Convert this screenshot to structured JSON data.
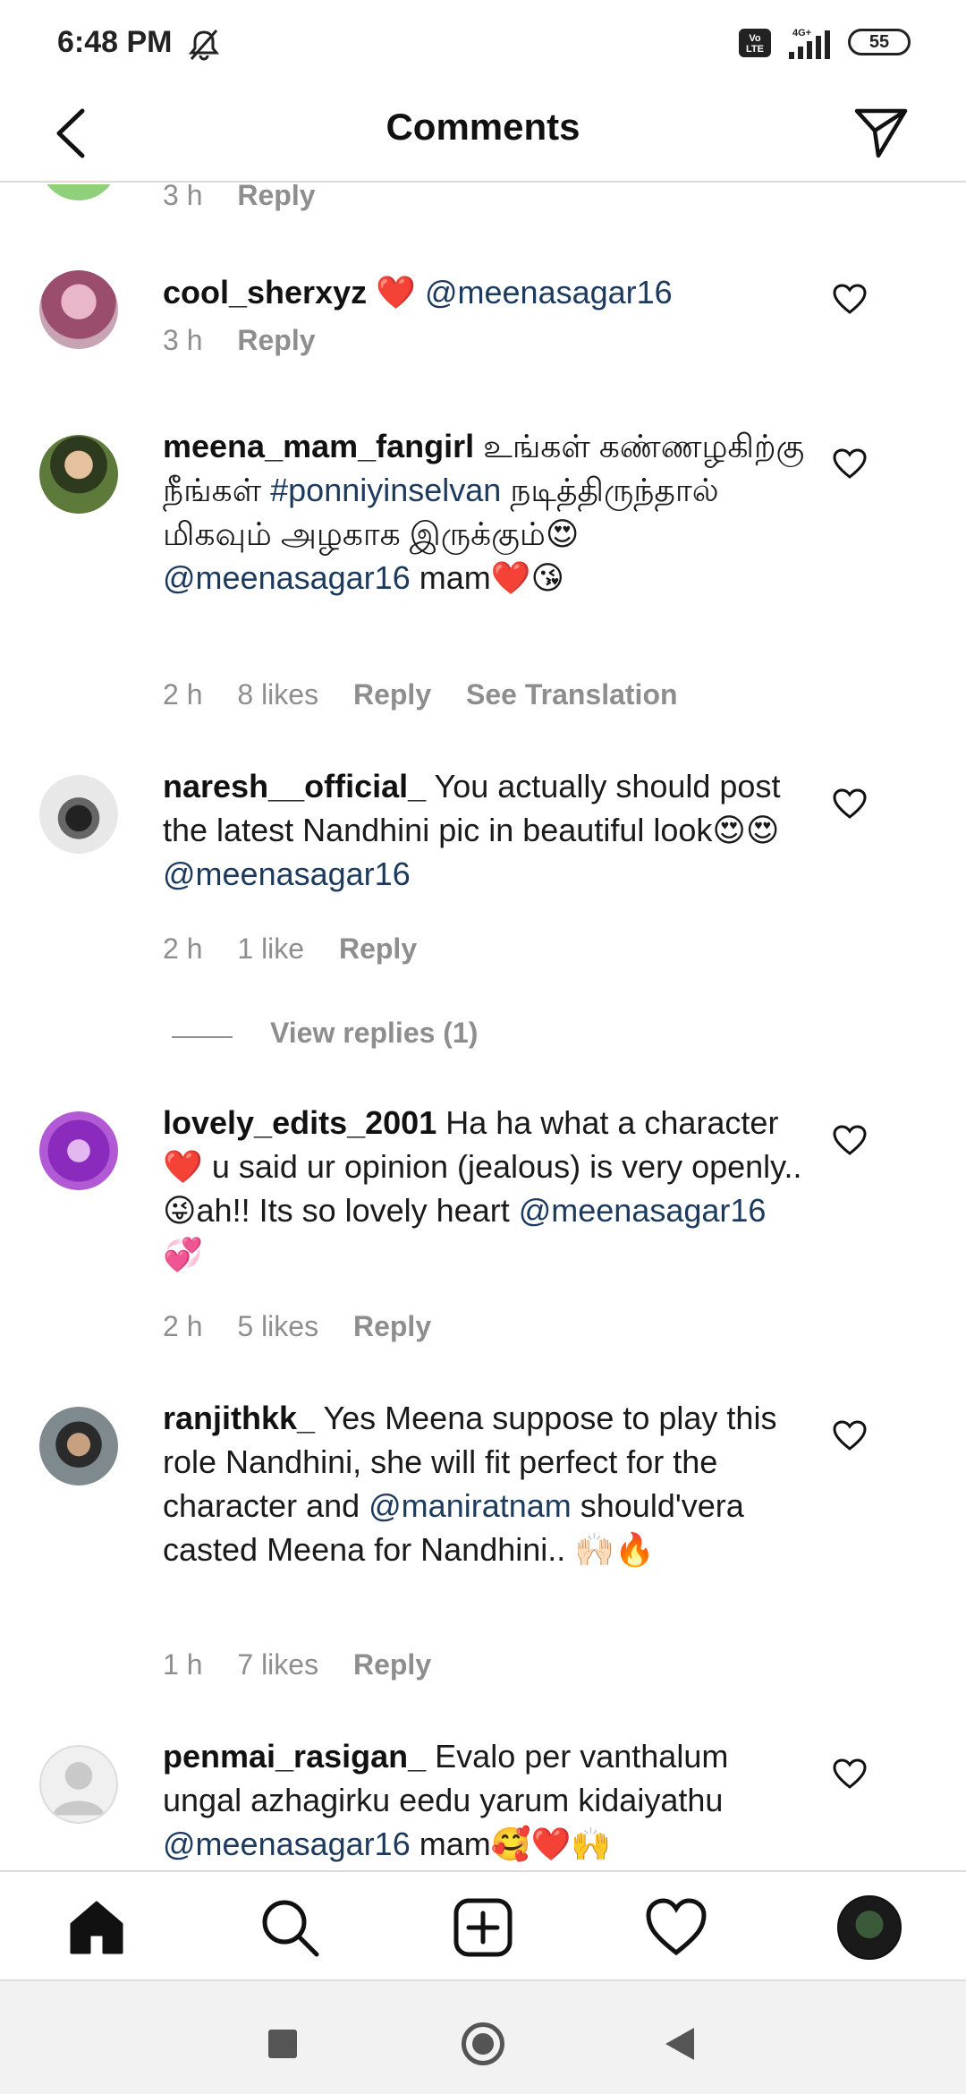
{
  "status_bar": {
    "time": "6:48 PM",
    "volte": "Vo LTE",
    "network": "4G+",
    "battery": "55"
  },
  "header": {
    "title": "Comments"
  },
  "top_partial": {
    "time": "3 h",
    "reply": "Reply"
  },
  "comments": [
    {
      "username": "cool_sherxyz",
      "text_parts": [
        "❤️ ",
        "@meenasagar16"
      ],
      "time": "3 h",
      "likes": "",
      "reply": "Reply"
    },
    {
      "username": "meena_mam_fangirl",
      "text1": "உங்கள் கண்ணழகிற்கு நீங்கள் ",
      "hashtag": "#ponniyinselvan",
      "text2": " நடித்திருந்தால் மிகவும் அழகாக இருக்கும்😍 ",
      "mention": "@meenasagar16",
      "text3": " mam❤️😘",
      "time": "2 h",
      "likes": "8 likes",
      "reply": "Reply",
      "translate": "See Translation"
    },
    {
      "username": "naresh__official_",
      "text1": "You actually should post the latest Nandhini pic in beautiful look😍😍 ",
      "mention": "@meenasagar16",
      "time": "2 h",
      "likes": "1 like",
      "reply": "Reply",
      "view_replies": "View replies (1)"
    },
    {
      "username": "lovely_edits_2001",
      "text1": "Ha ha what a character ❤️ u said ur opinion (jealous) is very openly.. 😜ah!! Its so lovely heart ",
      "mention": "@meenasagar16",
      "text2": " 💞",
      "time": "2 h",
      "likes": "5 likes",
      "reply": "Reply"
    },
    {
      "username": "ranjithkk_",
      "text1": "Yes Meena suppose to play this role Nandhini, she will fit perfect for the character and ",
      "mention": "@maniratnam",
      "text2": " should'vera casted Meena for Nandhini.. 🙌🏻🔥",
      "time": "1 h",
      "likes": "7 likes",
      "reply": "Reply"
    },
    {
      "username": "penmai_rasigan_",
      "text1": "Evalo per vanthalum ungal azhagirku eedu yarum kidaiyathu ",
      "mention": "@meenasagar16",
      "text2": " mam🥰❤️🙌"
    }
  ],
  "bottom_nav": [
    "home-icon",
    "search-icon",
    "new-post-icon",
    "activity-icon",
    "profile-avatar"
  ],
  "colors": {
    "mention": "#1c3a5e",
    "meta": "#8e8e8e",
    "heart_red": "#e0245e"
  }
}
